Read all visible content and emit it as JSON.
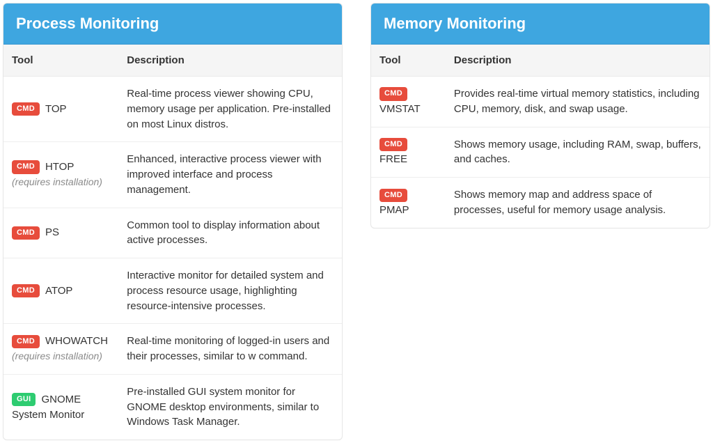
{
  "headers": {
    "tool": "Tool",
    "description": "Description"
  },
  "badges": {
    "cmd": "CMD",
    "gui": "GUI"
  },
  "panels": [
    {
      "title": "Process Monitoring",
      "rows": [
        {
          "badge_key": "cmd",
          "name": "TOP",
          "note": "",
          "break_before_note": false,
          "desc": "Real-time process viewer showing CPU, memory usage per application. Pre-installed on most Linux distros."
        },
        {
          "badge_key": "cmd",
          "name": "HTOP",
          "note": "(requires installation)",
          "break_before_note": false,
          "desc": "Enhanced, interactive process viewer with improved interface and process management."
        },
        {
          "badge_key": "cmd",
          "name": "PS",
          "note": "",
          "break_before_note": false,
          "desc": "Common tool to display information about active processes."
        },
        {
          "badge_key": "cmd",
          "name": "ATOP",
          "note": "",
          "break_before_note": false,
          "desc": "Interactive monitor for detailed system and process resource usage, highlighting resource-intensive processes."
        },
        {
          "badge_key": "cmd",
          "name": "WHOWATCH",
          "note": "(requires installation)",
          "break_before_note": true,
          "desc": "Real-time monitoring of logged-in users and their processes, similar to w command."
        },
        {
          "badge_key": "gui",
          "name": "GNOME System Monitor",
          "note": "",
          "break_before_note": false,
          "desc": "Pre-installed GUI system monitor for GNOME desktop environments, similar to Windows Task Manager."
        }
      ]
    },
    {
      "title": "Memory Monitoring",
      "rows": [
        {
          "badge_key": "cmd",
          "name": "VMSTAT",
          "note": "",
          "break_before_note": false,
          "desc": "Provides real-time virtual memory statistics, including CPU, memory, disk, and swap usage."
        },
        {
          "badge_key": "cmd",
          "name": "FREE",
          "note": "",
          "break_before_note": false,
          "desc": "Shows memory usage, including RAM, swap, buffers, and caches."
        },
        {
          "badge_key": "cmd",
          "name": "PMAP",
          "note": "",
          "break_before_note": false,
          "desc": "Shows memory map and address space of processes, useful for memory usage analysis."
        }
      ]
    }
  ]
}
